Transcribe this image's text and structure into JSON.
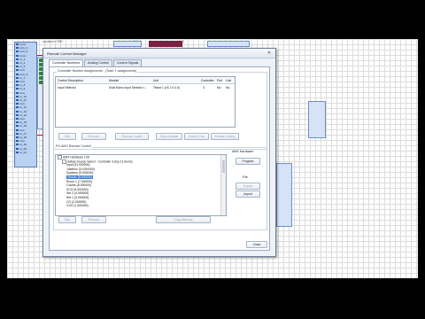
{
  "background": {
    "header_items": [
      "xpodsiam CHB2",
      "xxxxxxxx_0x0",
      "xxxxxxxxx_0xO",
      "xxxxxxxxx"
    ],
    "left_panel_items": [
      "xxxxx",
      "xxxx_1",
      "xxxx_2",
      "xxxxx",
      "xx_3",
      "xx_4",
      "xx_5",
      "xxxx",
      "xxxx_6",
      "xx_7",
      "xxxx",
      "xx_8",
      "xx_9",
      "xxxx",
      "xx_10",
      "xx_11",
      "xxxx",
      "xx_12",
      "xx_13",
      "xx_14",
      "xxxx",
      "xx_15",
      "xx_16",
      "xxxx",
      "xx_17",
      "xx_18",
      "xxxx",
      "xx_19",
      "xx_20",
      "xx_21"
    ]
  },
  "dialog": {
    "title": "Remote Control Manager",
    "close_glyph": "✕",
    "tabs": [
      "Controller Numbers",
      "Analog Control",
      "Control Signals"
    ],
    "controller_group": {
      "label": "Controller Number Assignments - (Total: 1 assignments)",
      "columns": [
        "Control Description",
        "Module",
        "Unit",
        "Controller",
        "Port",
        "Link"
      ],
      "rows": [
        [
          "Input Selector",
          "Dual Mono Input Selector I...",
          "Tesira 1 (v3.7.0.4.0)",
          "3",
          "No",
          "No"
        ]
      ],
      "buttons": [
        "Edit",
        "Remove",
        "Remove Invalid",
        "Show Module",
        "Enable Port",
        "Enable Linking"
      ]
    },
    "amx_group": {
      "label": "PS-AMX Remote Control",
      "tree": [
        {
          "text": "AMX Hardware 128",
          "level": 0,
          "exp": "−",
          "selected": false
        },
        {
          "text": "Safety Source Select - Controller 3 (top 11 items)",
          "level": 1,
          "exp": "−",
          "selected": false
        },
        {
          "text": "Input (11.000000)",
          "level": 2,
          "exp": "",
          "selected": false
        },
        {
          "text": "Jukebox (10.000000)",
          "level": 2,
          "exp": "",
          "selected": false
        },
        {
          "text": "Systems (9.000000)",
          "level": 2,
          "exp": "",
          "selected": false
        },
        {
          "text": "Vendor (8.000000)",
          "level": 2,
          "exp": "",
          "selected": true
        },
        {
          "text": "Room 1 (7.000000)",
          "level": 2,
          "exp": "",
          "selected": false
        },
        {
          "text": "Counts (6.000000)",
          "level": 2,
          "exp": "",
          "selected": false
        },
        {
          "text": "XCO (5.000000)",
          "level": 2,
          "exp": "",
          "selected": false
        },
        {
          "text": "Set 2 (4.000000)",
          "level": 2,
          "exp": "",
          "selected": false
        },
        {
          "text": "Set 1 (3.000000)",
          "level": 2,
          "exp": "",
          "selected": false
        },
        {
          "text": "CO (2.000000)",
          "level": 2,
          "exp": "",
          "selected": false
        },
        {
          "text": "CXO (1.000000)",
          "level": 2,
          "exp": "",
          "selected": false
        }
      ],
      "side_label": "AMX Hardware",
      "side_buttons": [
        "Program",
        "File",
        "Export",
        "Import"
      ],
      "bottom_buttons": [
        "Edit",
        "Remove",
        "Copy Memory"
      ]
    },
    "close_button": "Close"
  }
}
